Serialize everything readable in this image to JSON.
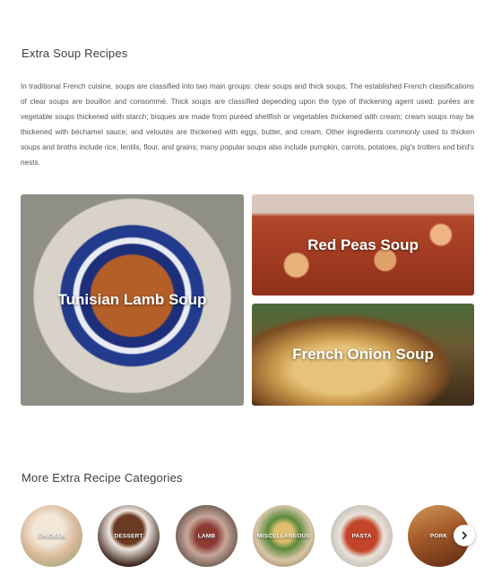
{
  "extra_section": {
    "title": "Extra Soup Recipes",
    "intro": "In traditional French cuisine, soups are classified into two main groups: clear soups and thick soups. The established French classifications of clear soups are bouillon and consommé. Thick soups are classified depending upon the type of thickening agent used: purées are vegetable soups thickened with starch; bisques are made from puréed shellfish or vegetables thickened with cream; cream soups may be thickened with béchamel sauce; and veloutés are thickened with eggs, butter, and cream. Other ingredients commonly used to thicken soups and broths include rice, lentils, flour, and grains; many popular soups also include pumpkin, carrots, potatoes, pig's trotters and bird's nests."
  },
  "recipe_cards": {
    "tunisian": "Tunisian Lamb Soup",
    "redpeas": "Red Peas Soup",
    "onion": "French Onion Soup"
  },
  "categories_section": {
    "title": "More Extra Recipe Categories",
    "items": [
      "CHICKEN",
      "DESSERT",
      "LAMB",
      "MISCELLANEOUS",
      "PASTA",
      "PORK"
    ],
    "next_icon": "chevron-right-icon"
  }
}
